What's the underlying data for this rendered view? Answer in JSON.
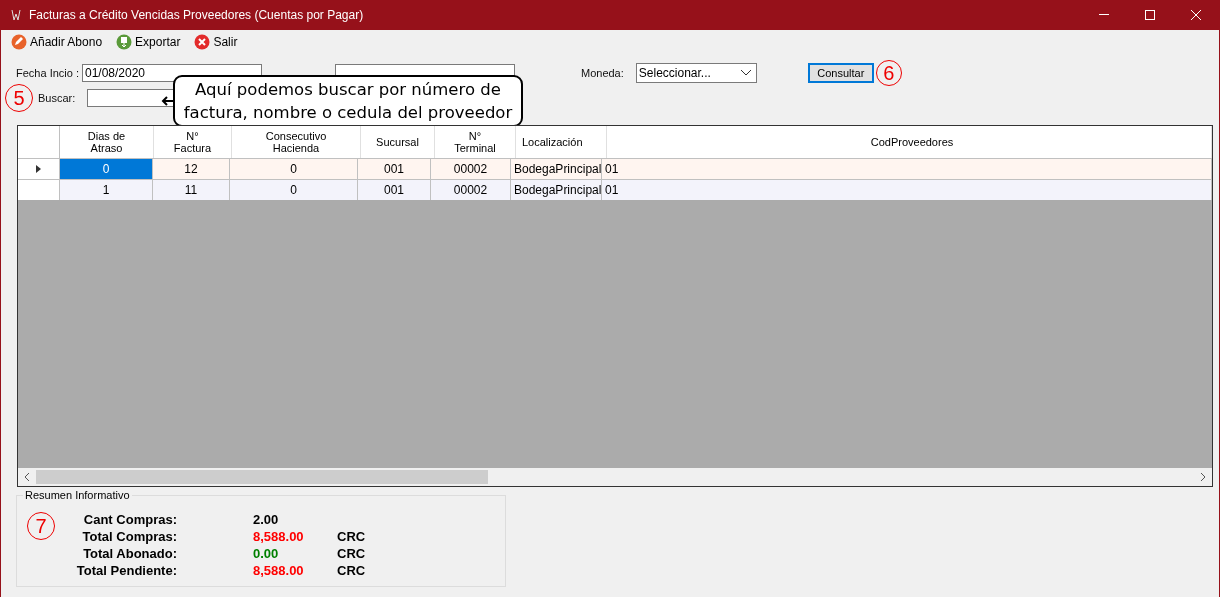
{
  "window": {
    "title": "Facturas a Crédito Vencidas Proveedores (Cuentas por Pagar)"
  },
  "toolbar": [
    {
      "label": "Añadir Abono",
      "kind": "add"
    },
    {
      "label": "Exportar",
      "kind": "export"
    },
    {
      "label": "Salir",
      "kind": "exit"
    }
  ],
  "filters": {
    "start_label": "Fecha Incio :",
    "start_value": "01/08/2020",
    "currency_label": "Moneda:",
    "currency_value": "Seleccionar...",
    "search_label": "Buscar:",
    "query_button": "Consultar"
  },
  "annotations": [
    {
      "number": "5"
    },
    {
      "number": "6"
    },
    {
      "number": "7"
    }
  ],
  "callout": {
    "text": "Aquí podemos buscar por número de factura, nombre o cedula del proveedor"
  },
  "table": {
    "columns": [
      "Dias de Atraso",
      "N° Factura",
      "Consecutivo Hacienda",
      "Sucursal",
      "N° Terminal",
      "Localización",
      "CodProveedores"
    ],
    "rows": [
      {
        "selected": true,
        "cells": [
          "0",
          "12",
          "0",
          "001",
          "00002",
          "BodegaPrincipal",
          "01"
        ]
      },
      {
        "selected": false,
        "cells": [
          "1",
          "11",
          "0",
          "001",
          "00002",
          "BodegaPrincipal",
          "01"
        ]
      }
    ]
  },
  "summary": {
    "title": "Resumen Informativo",
    "items": [
      {
        "label": "Cant Compras:",
        "value": "2.00",
        "color": "#000000"
      },
      {
        "label": "Total Compras:",
        "value": "8,588.00",
        "currency": "CRC",
        "color": "#ff0000"
      },
      {
        "label": "Total Abonado:",
        "value": "0.00",
        "currency": "CRC",
        "color": "#008000"
      },
      {
        "label": "Total Pendiente:",
        "value": "8,588.00",
        "currency": "CRC",
        "color": "#ff0000"
      }
    ]
  }
}
